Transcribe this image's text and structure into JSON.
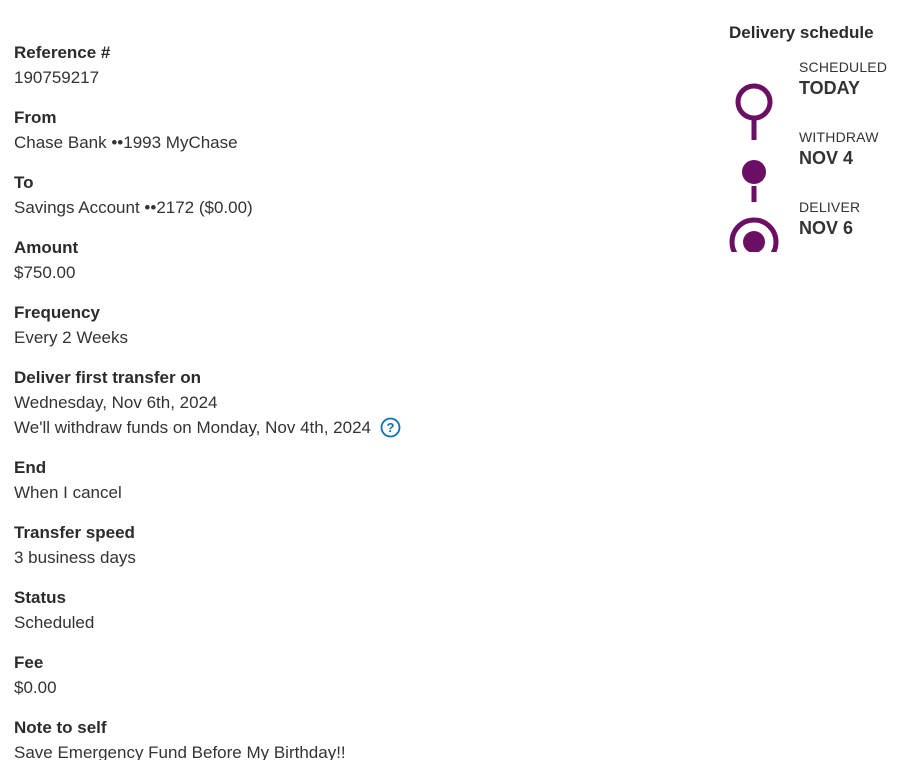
{
  "details": {
    "reference": {
      "label": "Reference #",
      "value": "190759217"
    },
    "from": {
      "label": "From",
      "value": "Chase Bank ••1993 MyChase"
    },
    "to": {
      "label": "To",
      "value": "Savings Account ••2172 ($0.00)"
    },
    "amount": {
      "label": "Amount",
      "value": "$750.00"
    },
    "frequency": {
      "label": "Frequency",
      "value": "Every 2 Weeks"
    },
    "deliver_first": {
      "label": "Deliver first transfer on",
      "value": "Wednesday, Nov 6th, 2024",
      "withdraw_note": "We'll withdraw funds on Monday, Nov 4th, 2024"
    },
    "end": {
      "label": "End",
      "value": "When I cancel"
    },
    "transfer_speed": {
      "label": "Transfer speed",
      "value": "3 business days"
    },
    "status": {
      "label": "Status",
      "value": "Scheduled"
    },
    "fee": {
      "label": "Fee",
      "value": "$0.00"
    },
    "note": {
      "label": "Note to self",
      "value": "Save Emergency Fund Before My Birthday!!"
    }
  },
  "schedule": {
    "title": "Delivery schedule",
    "steps": [
      {
        "caption": "SCHEDULED",
        "date": "TODAY",
        "icon": "hollow-circle-icon"
      },
      {
        "caption": "WITHDRAW",
        "date": "NOV 4",
        "icon": "filled-dot-icon"
      },
      {
        "caption": "DELIVER",
        "date": "NOV 6",
        "icon": "target-circle-icon"
      }
    ]
  },
  "colors": {
    "accent": "#6a0f64",
    "help_icon": "#0b6fb5",
    "text": "#333333"
  }
}
